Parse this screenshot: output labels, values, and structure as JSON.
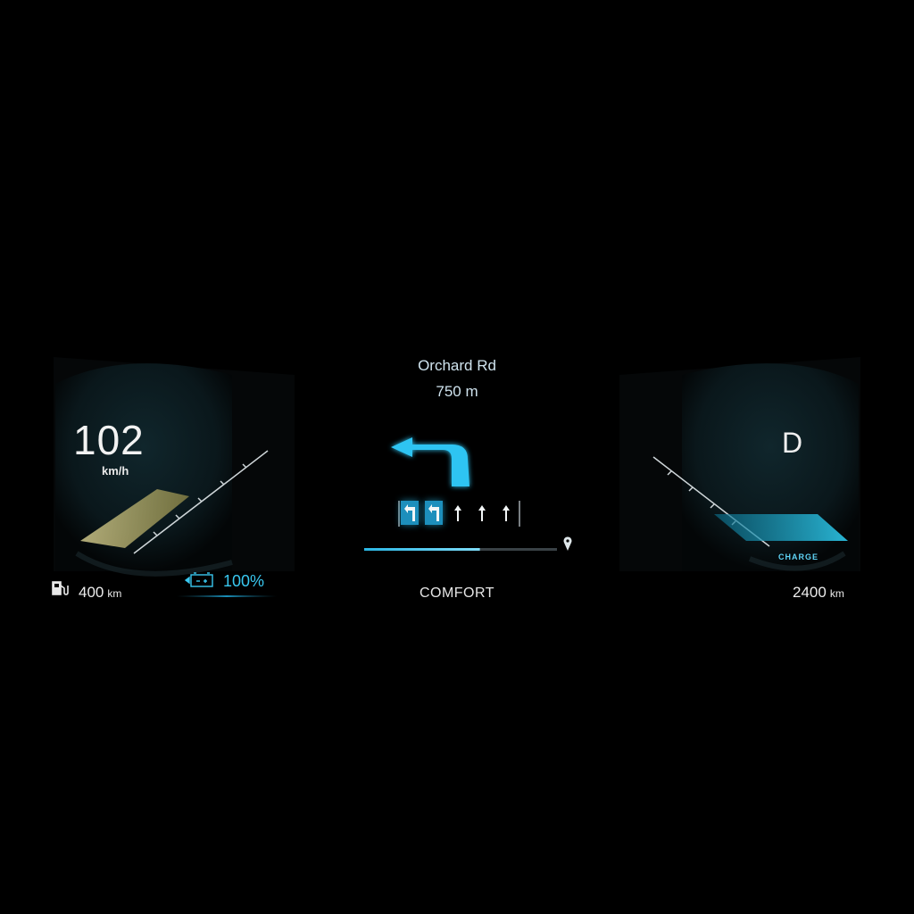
{
  "speed": {
    "value": "102",
    "unit": "km/h"
  },
  "gear": "D",
  "navigation": {
    "street": "Orchard Rd",
    "distance": "750 m",
    "route_progress": 0.6,
    "lanes": [
      "turn-left",
      "turn-left",
      "straight",
      "straight",
      "straight"
    ],
    "active_lanes": [
      0,
      1
    ]
  },
  "drive_mode": "COMFORT",
  "fuel_range": {
    "value": "400",
    "unit": "km"
  },
  "battery": {
    "percent_text": "100%",
    "level": 1.0
  },
  "total_range": {
    "value": "2400",
    "unit": "km"
  },
  "charge_label": "CHARGE",
  "icons": {
    "fuel": "fuel-pump-icon",
    "battery": "battery-charge-icon",
    "destination": "location-pin-icon",
    "turn": "turn-left-arrow-icon"
  },
  "colors": {
    "accent": "#2ec4f2",
    "speed_gauge": "#d8cf86",
    "background": "#000000"
  }
}
